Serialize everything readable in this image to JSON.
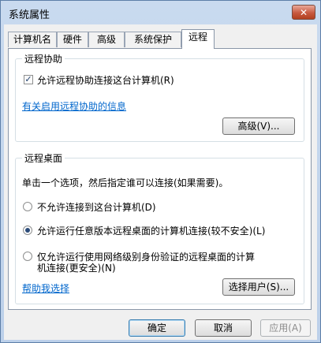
{
  "window": {
    "title": "系统属性",
    "close_label": "✕"
  },
  "tabs": [
    {
      "label": "计算机名"
    },
    {
      "label": "硬件"
    },
    {
      "label": "高级"
    },
    {
      "label": "系统保护"
    },
    {
      "label": "远程",
      "active": true
    }
  ],
  "remote_assistance": {
    "group_label": "远程协助",
    "allow_label": "允许远程协助连接这台计算机(R)",
    "allow_checked": true,
    "info_link": "有关启用远程协助的信息",
    "advanced_button": "高级(V)..."
  },
  "remote_desktop": {
    "group_label": "远程桌面",
    "instruction": "单击一个选项，然后指定谁可以连接(如果需要)。",
    "options": [
      {
        "label": "不允许连接到这台计算机(D)",
        "selected": false
      },
      {
        "label": "允许运行任意版本远程桌面的计算机连接(较不安全)(L)",
        "selected": true
      },
      {
        "label_line1": "仅允许运行使用网络级别身份验证的远程桌面的计算",
        "label_line2": "机连接(更安全)(N)",
        "selected": false
      }
    ],
    "help_link": "帮助我选择",
    "select_users_button": "选择用户(S)..."
  },
  "footer": {
    "ok_button": "确定",
    "cancel_button": "取消",
    "apply_button": "应用(A)"
  }
}
